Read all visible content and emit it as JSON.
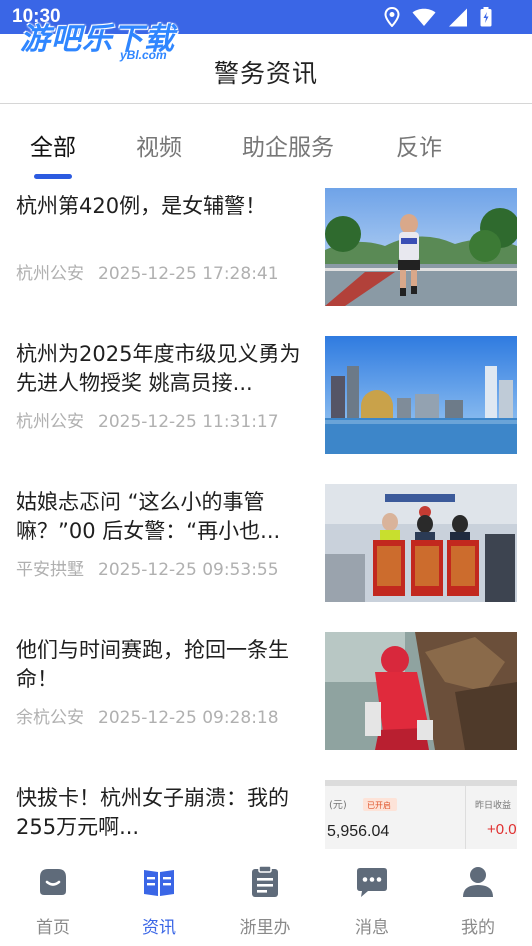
{
  "status_bar": {
    "time": "10:30"
  },
  "watermark": {
    "main": "游吧乐下载",
    "sub": "yBl.com"
  },
  "header": {
    "title": "警务资讯"
  },
  "tabs": [
    {
      "label": "全部",
      "active": true
    },
    {
      "label": "视频",
      "active": false
    },
    {
      "label": "助企服务",
      "active": false
    },
    {
      "label": "反诈",
      "active": false
    }
  ],
  "news": [
    {
      "title": "杭州第420例，是女辅警！",
      "source": "杭州公安",
      "time": "2025-12-25 17:28:41"
    },
    {
      "title": "杭州为2025年度市级见义勇为先进人物授奖 姚高员接...",
      "source": "杭州公安",
      "time": "2025-12-25 11:31:17"
    },
    {
      "title": "姑娘忐忑问 “这么小的事管嘛？”00 后女警：“再小也...",
      "source": "平安拱墅",
      "time": "2025-12-25 09:53:55"
    },
    {
      "title": "他们与时间赛跑，抢回一条生命！",
      "source": "余杭公安",
      "time": "2025-12-25 09:28:18"
    },
    {
      "title": "快拔卡！杭州女子崩溃：我的255万元啊...",
      "source": "",
      "time": ""
    }
  ],
  "thumb5": {
    "unit": "(元)",
    "badge": "已开启",
    "amount": "5,956.04",
    "right_label": "昨日收益",
    "right_value": "+0.0"
  },
  "bottom_nav": [
    {
      "label": "首页",
      "icon": "home-icon",
      "active": false
    },
    {
      "label": "资讯",
      "icon": "book-icon",
      "active": true
    },
    {
      "label": "浙里办",
      "icon": "clipboard-icon",
      "active": false
    },
    {
      "label": "消息",
      "icon": "chat-icon",
      "active": false
    },
    {
      "label": "我的",
      "icon": "person-icon",
      "active": false
    }
  ],
  "colors": {
    "accent": "#3a66e6",
    "indicator": "#2c5be0",
    "status_bar": "#3a66e6",
    "meta_text": "#b0b0b0",
    "inactive_nav": "#8a8a8a"
  }
}
